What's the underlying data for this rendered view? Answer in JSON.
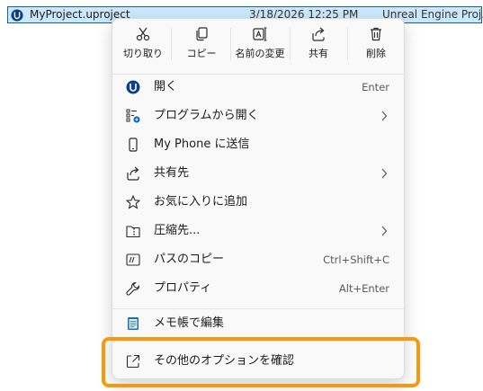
{
  "file_row": {
    "name": "MyProject.uproject",
    "date": "3/18/2026 12:25 PM",
    "type": "Unreal Engine Proj..."
  },
  "toolbar": {
    "cut": "切り取り",
    "copy": "コピー",
    "rename": "名前の変更",
    "share": "共有",
    "delete": "削除"
  },
  "menu": {
    "open": {
      "label": "開く",
      "shortcut": "Enter"
    },
    "open_with": {
      "label": "プログラムから開く"
    },
    "send_to_phone": {
      "label": "My Phone に送信"
    },
    "share_to": {
      "label": "共有先"
    },
    "add_favorites": {
      "label": "お気に入りに追加"
    },
    "compress": {
      "label": "圧縮先..."
    },
    "copy_path": {
      "label": "パスのコピー",
      "shortcut": "Ctrl+Shift+C"
    },
    "properties": {
      "label": "プロパティ",
      "shortcut": "Alt+Enter"
    },
    "notepad": {
      "label": "メモ帳で編集"
    },
    "more_options": {
      "label": "その他のオプションを確認"
    }
  },
  "icons": {
    "cut": "scissors-icon",
    "copy": "copy-icon",
    "rename": "rename-icon",
    "share": "share-icon",
    "delete": "trash-icon",
    "open": "unreal-engine-icon",
    "open_with": "apps-icon",
    "send_to_phone": "phone-icon",
    "share_to": "share-icon",
    "favorites": "star-icon",
    "compress": "zip-folder-icon",
    "copy_path": "path-icon",
    "properties": "wrench-icon",
    "notepad": "notepad-icon",
    "more_options": "expand-icon"
  },
  "colors": {
    "accent": "#0a62b8",
    "selection": "#cce8ff",
    "highlight": "#f6990f",
    "menu_bg": "#f9f9f9"
  }
}
